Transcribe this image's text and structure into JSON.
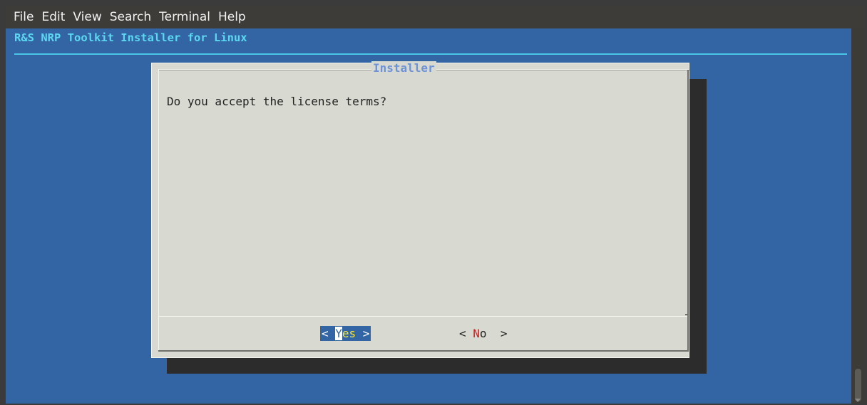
{
  "menu": [
    "File",
    "Edit",
    "View",
    "Search",
    "Terminal",
    "Help"
  ],
  "backtitle": "R&S NRP Toolkit Installer for Linux",
  "dialog": {
    "title": "Installer",
    "question": "Do you accept the license terms?"
  },
  "buttons": {
    "yes": {
      "left": "< ",
      "hot": "Y",
      "rest": "es",
      "right": " >"
    },
    "no": {
      "left": "< ",
      "hot": "N",
      "rest": "o",
      "right": "  >"
    }
  },
  "colors": {
    "terminal_bg": "#3364a4",
    "dialog_bg": "#d8d9d1",
    "title": "#6d93d4",
    "backtitle": "#5bd8f0",
    "hotkey_no": "#cc1f1f",
    "yes_text": "#f5e53a"
  }
}
